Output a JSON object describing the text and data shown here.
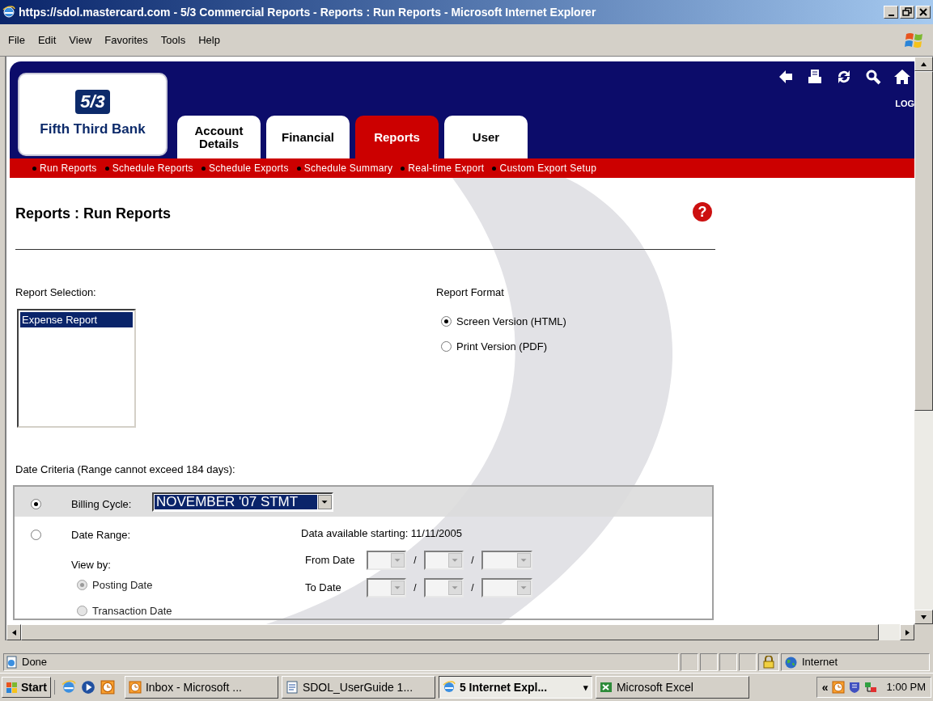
{
  "window": {
    "title": "https://sdol.mastercard.com - 5/3 Commercial Reports - Reports : Run Reports - Microsoft Internet Explorer"
  },
  "menu": [
    "File",
    "Edit",
    "View",
    "Favorites",
    "Tools",
    "Help"
  ],
  "bank": {
    "logo_text": "5/3",
    "name": "Fifth Third Bank"
  },
  "header_link": "LOG",
  "tabs": [
    {
      "label": "Account Details",
      "selected": false
    },
    {
      "label": "Financial",
      "selected": false
    },
    {
      "label": "Reports",
      "selected": true
    },
    {
      "label": "User",
      "selected": false
    }
  ],
  "subnav": [
    "Run Reports",
    "Schedule Reports",
    "Schedule Exports",
    "Schedule Summary",
    "Real-time Export",
    "Custom Export Setup"
  ],
  "page": {
    "title": "Reports : Run Reports",
    "help": "?"
  },
  "report_selection": {
    "label": "Report Selection:",
    "items": [
      {
        "label": "Expense Report",
        "selected": true
      }
    ]
  },
  "report_format": {
    "label": "Report Format",
    "options": [
      {
        "label": "Screen Version (HTML)",
        "selected": true
      },
      {
        "label": "Print Version (PDF)",
        "selected": false
      }
    ]
  },
  "date_criteria": {
    "label": "Date Criteria (Range cannot exceed 184 days):",
    "billing_cycle": {
      "selected": true,
      "label": "Billing Cycle:",
      "value": "NOVEMBER '07 STMT"
    },
    "date_range": {
      "selected": false,
      "disabled": true,
      "label": "Date Range:",
      "note": "Data available starting: 11/11/2005",
      "view_by_label": "View by:",
      "view_by": [
        {
          "label": "Posting Date",
          "selected": true
        },
        {
          "label": "Transaction Date",
          "selected": false
        }
      ],
      "rows": [
        {
          "label": "From Date",
          "separators": [
            "/",
            "/"
          ]
        },
        {
          "label": "To Date",
          "separators": [
            "/",
            "/"
          ]
        }
      ]
    }
  },
  "status_bar": {
    "text": "Done",
    "zone": "Internet"
  },
  "taskbar": {
    "start": "Start",
    "buttons": [
      {
        "label": "Inbox - Microsoft ...",
        "kind": "clock",
        "selected": false
      },
      {
        "label": "SDOL_UserGuide 1...",
        "kind": "document",
        "selected": false
      },
      {
        "label": "5 Internet Expl...",
        "kind": "browser",
        "selected": true,
        "caret": "▾"
      },
      {
        "label": "Microsoft Excel",
        "kind": "spreadsheet",
        "selected": false
      }
    ],
    "tray_chevron": "«",
    "clock": "1:00 PM"
  }
}
